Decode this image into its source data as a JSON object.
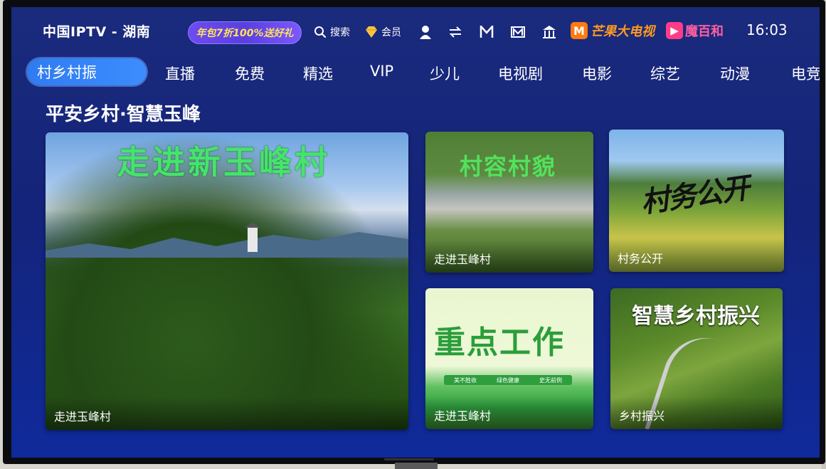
{
  "top_bar": {
    "brand": "中国IPTV - 湖南",
    "promo": "年包7折100%送好礼",
    "search_label": "搜索",
    "member_label": "会员",
    "partner_mango": "芒果大电视",
    "partner_mobaihe": "魔百和",
    "clock": "16:03",
    "icons": [
      "search-icon",
      "vip-diamond-icon",
      "user-icon",
      "switch-icon",
      "app-icon-n",
      "app-icon-m",
      "building-icon"
    ]
  },
  "nav": {
    "tabs": [
      "村乡村振",
      "直播",
      "免费",
      "精选",
      "VIP",
      "少儿",
      "电视剧",
      "电影",
      "综艺",
      "动漫",
      "电竞"
    ],
    "active_index": 0
  },
  "section": {
    "title": "平安乡村·智慧玉峰"
  },
  "cards": [
    {
      "overlay": "走进新玉峰村",
      "caption": "走进玉峰村"
    },
    {
      "overlay": "村容村貌",
      "caption": "走进玉峰村"
    },
    {
      "overlay": "村务公开",
      "caption": "村务公开"
    },
    {
      "overlay": "重点工作",
      "caption": "走进玉峰村",
      "banner": [
        "美不胜收",
        "绿色健康",
        "史无前例"
      ]
    },
    {
      "overlay": "智慧乡村振兴",
      "caption": "乡村振兴"
    }
  ],
  "colors": {
    "active_tab": "#3d8dff",
    "screen_bg": "#14247a",
    "mango": "#ff9a1f",
    "mobaihe": "#ff5fa0"
  }
}
